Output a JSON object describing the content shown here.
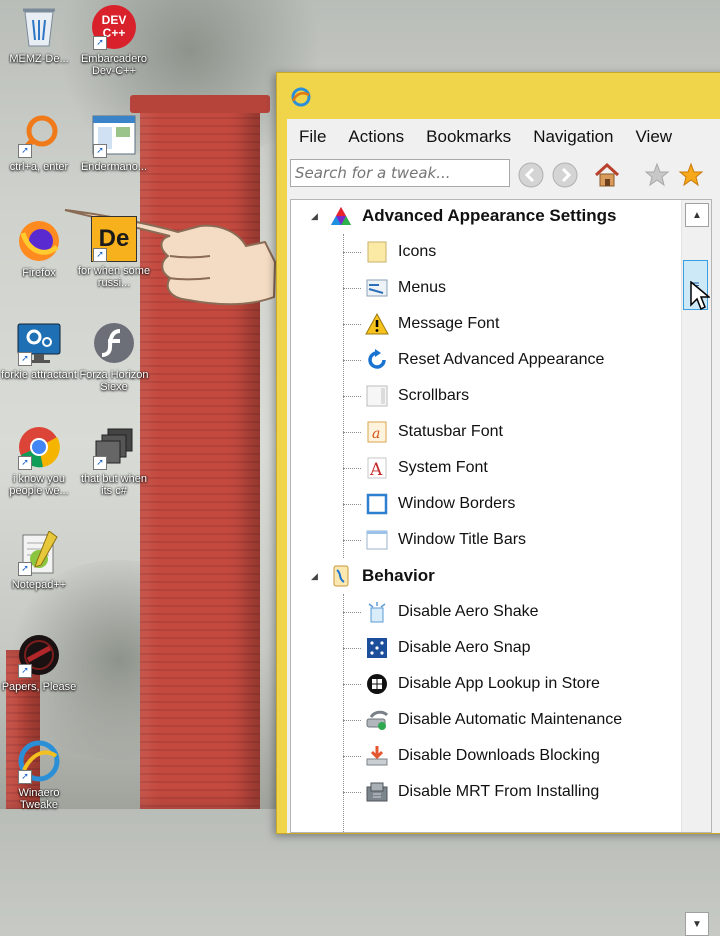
{
  "desktop_icons": [
    {
      "label": "MEMZ-De...",
      "icon": "recycle-bin-icon"
    },
    {
      "label": "Embarcadero Dev-C++",
      "icon": "devcpp-icon",
      "badge": "DEV\nC++"
    },
    {
      "label": "ctrl+a, enter",
      "icon": "magnifier-icon"
    },
    {
      "label": "Endermano...",
      "icon": "window-app-icon"
    },
    {
      "label": "Firefox",
      "icon": "firefox-icon"
    },
    {
      "label": "for when some russi...",
      "icon": "de-app-icon",
      "badge": "De"
    },
    {
      "label": "forkie attractant",
      "icon": "monitor-gear-icon"
    },
    {
      "label": "Forza Horizon Siexe",
      "icon": "flash-icon"
    },
    {
      "label": "i know you people we...",
      "icon": "chrome-icon"
    },
    {
      "label": "that but when its c#",
      "icon": "stack-windows-icon"
    },
    {
      "label": "Notepad++",
      "icon": "notepadpp-icon"
    },
    {
      "label": "Papers, Please",
      "icon": "papers-please-icon"
    },
    {
      "label": "Winaero Tweake",
      "icon": "winaero-icon"
    }
  ],
  "window": {
    "menu": [
      "File",
      "Actions",
      "Bookmarks",
      "Navigation",
      "View"
    ],
    "search_placeholder": "Search for a tweak...",
    "toolbar_icons": [
      "back-icon",
      "forward-icon",
      "home-icon",
      "add-bookmark-icon",
      "bookmarks-star-icon"
    ]
  },
  "tree": [
    {
      "label": "Advanced Appearance Settings",
      "icon": "appearance-icon",
      "items": [
        {
          "label": "Icons",
          "icon": "icons-folder-icon"
        },
        {
          "label": "Menus",
          "icon": "menus-icon"
        },
        {
          "label": "Message Font",
          "icon": "warning-icon"
        },
        {
          "label": "Reset Advanced Appearance",
          "icon": "reset-icon"
        },
        {
          "label": "Scrollbars",
          "icon": "scrollbar-icon"
        },
        {
          "label": "Statusbar Font",
          "icon": "statusbar-font-icon"
        },
        {
          "label": "System Font",
          "icon": "system-font-icon"
        },
        {
          "label": "Window Borders",
          "icon": "window-border-icon"
        },
        {
          "label": "Window Title Bars",
          "icon": "title-bar-icon"
        }
      ]
    },
    {
      "label": "Behavior",
      "icon": "behavior-icon",
      "items": [
        {
          "label": "Disable Aero Shake",
          "icon": "aero-shake-icon"
        },
        {
          "label": "Disable Aero Snap",
          "icon": "aero-snap-icon"
        },
        {
          "label": "Disable App Lookup in Store",
          "icon": "store-icon"
        },
        {
          "label": "Disable Automatic Maintenance",
          "icon": "maintenance-icon"
        },
        {
          "label": "Disable Downloads Blocking",
          "icon": "downloads-icon"
        },
        {
          "label": "Disable MRT From Installing",
          "icon": "mrt-icon"
        }
      ]
    }
  ],
  "colors": {
    "window_border": "#f0d44a",
    "scroll_thumb": "#cde8f7"
  }
}
